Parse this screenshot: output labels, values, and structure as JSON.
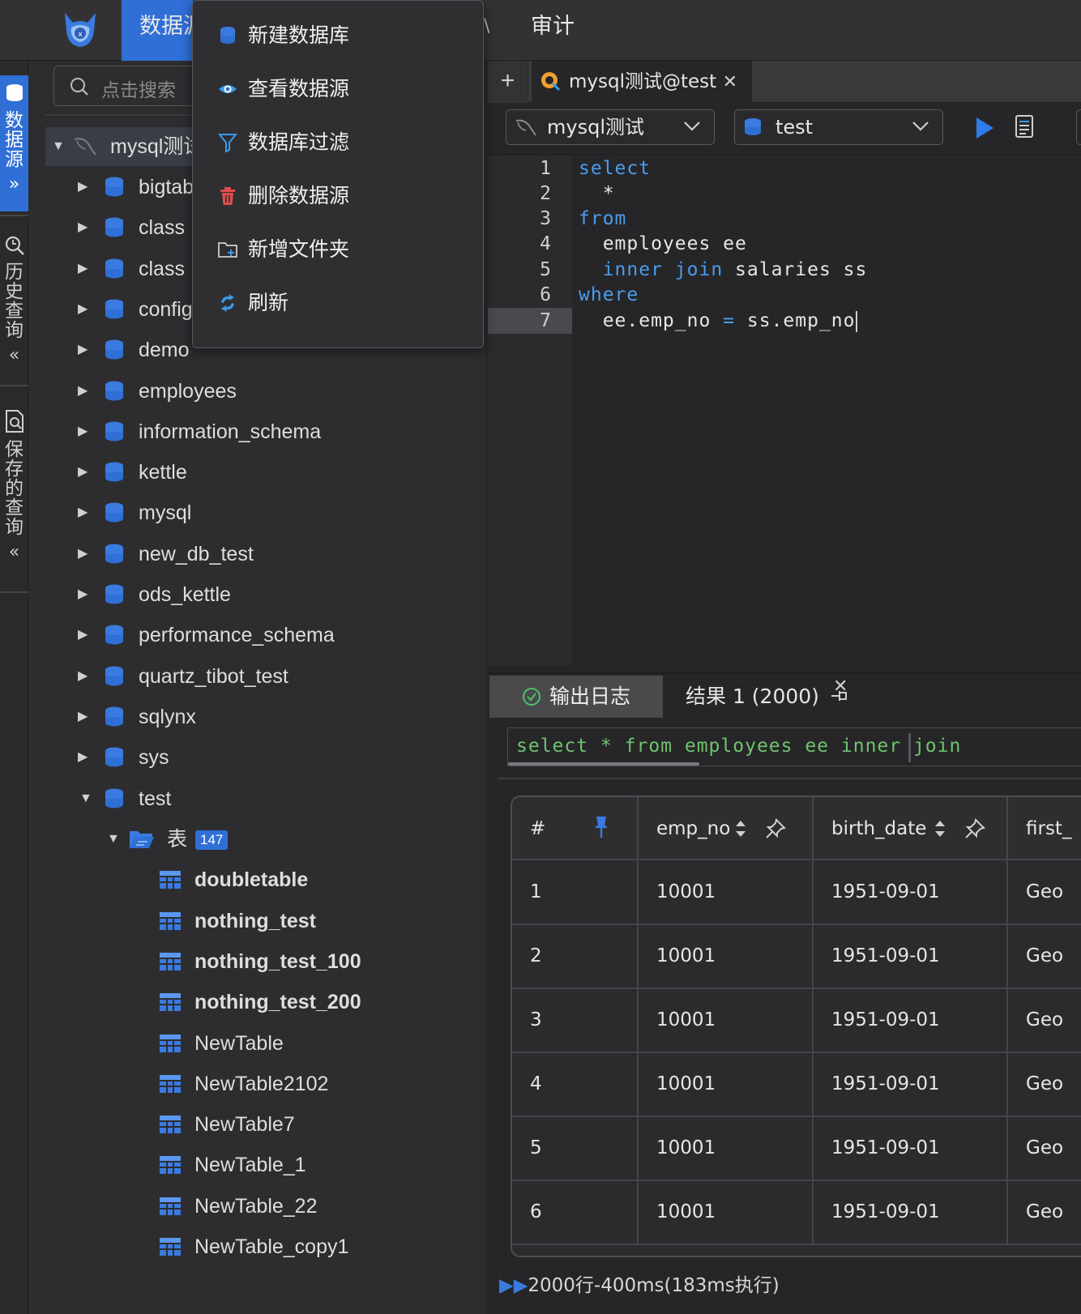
{
  "topnav": {
    "active_label": "数据源",
    "audit_label": "审计",
    "hidden_fragment": "\\"
  },
  "leftbar": {
    "datasource_label": "数据源",
    "history_label": "历史查询",
    "saved_label": "保存的查询",
    "expand_symbol": "»",
    "collapse_symbol": "«"
  },
  "tree": {
    "search_placeholder": "点击搜索",
    "root_label": "mysql测试",
    "databases": [
      "bigtable",
      "class",
      "class",
      "config",
      "demo",
      "employees",
      "information_schema",
      "kettle",
      "mysql",
      "new_db_test",
      "ods_kettle",
      "performance_schema",
      "quartz_tibot_test",
      "sqlynx",
      "sys",
      "test"
    ],
    "tables_folder": {
      "label": "表",
      "count": "147"
    },
    "tables": [
      "doubletable",
      "nothing_test",
      "nothing_test_100",
      "nothing_test_200",
      "NewTable",
      "NewTable2102",
      "NewTable7",
      "NewTable_1",
      "NewTable_22",
      "NewTable_copy1"
    ]
  },
  "context_menu": {
    "items": [
      {
        "label": "新建数据库",
        "icon": "database-icon"
      },
      {
        "label": "查看数据源",
        "icon": "eye-icon"
      },
      {
        "label": "数据库过滤",
        "icon": "filter-icon"
      },
      {
        "label": "删除数据源",
        "icon": "trash-icon"
      },
      {
        "label": "新增文件夹",
        "icon": "folder-add-icon"
      },
      {
        "label": "刷新",
        "icon": "refresh-icon"
      }
    ]
  },
  "editor": {
    "tab_label": "mysql测试@test",
    "datasource_select": "mysql测试",
    "database_select": "test",
    "line_numbers": [
      "1",
      "2",
      "3",
      "4",
      "5",
      "6",
      "7"
    ],
    "code": {
      "l1": "select",
      "l2": "  *",
      "l3": "from",
      "l4": "  employees ee",
      "l5_kw": "inner join",
      "l5_rest": " salaries ss",
      "l6": "where",
      "l7_a": "  ee.emp_no ",
      "l7_op": "=",
      "l7_b": " ss.emp_no"
    }
  },
  "results": {
    "log_tab_label": "输出日志",
    "result_tab_label": "结果 1 (2000)",
    "sql_preview": "select * from employees ee inner join",
    "columns": [
      "#",
      "emp_no",
      "birth_date",
      "first_"
    ],
    "rows": [
      {
        "n": "1",
        "emp_no": "10001",
        "birth_date": "1951-09-01",
        "first": "Geo"
      },
      {
        "n": "2",
        "emp_no": "10001",
        "birth_date": "1951-09-01",
        "first": "Geo"
      },
      {
        "n": "3",
        "emp_no": "10001",
        "birth_date": "1951-09-01",
        "first": "Geo"
      },
      {
        "n": "4",
        "emp_no": "10001",
        "birth_date": "1951-09-01",
        "first": "Geo"
      },
      {
        "n": "5",
        "emp_no": "10001",
        "birth_date": "1951-09-01",
        "first": "Geo"
      },
      {
        "n": "6",
        "emp_no": "10001",
        "birth_date": "1951-09-01",
        "first": "Geo"
      }
    ],
    "footer": "2000行-400ms(183ms执行)",
    "footer_arrow": "▶▶"
  },
  "colors": {
    "accent": "#2f6fd6",
    "keyword": "#4a9cf0",
    "sql_green": "#6fc36f"
  }
}
